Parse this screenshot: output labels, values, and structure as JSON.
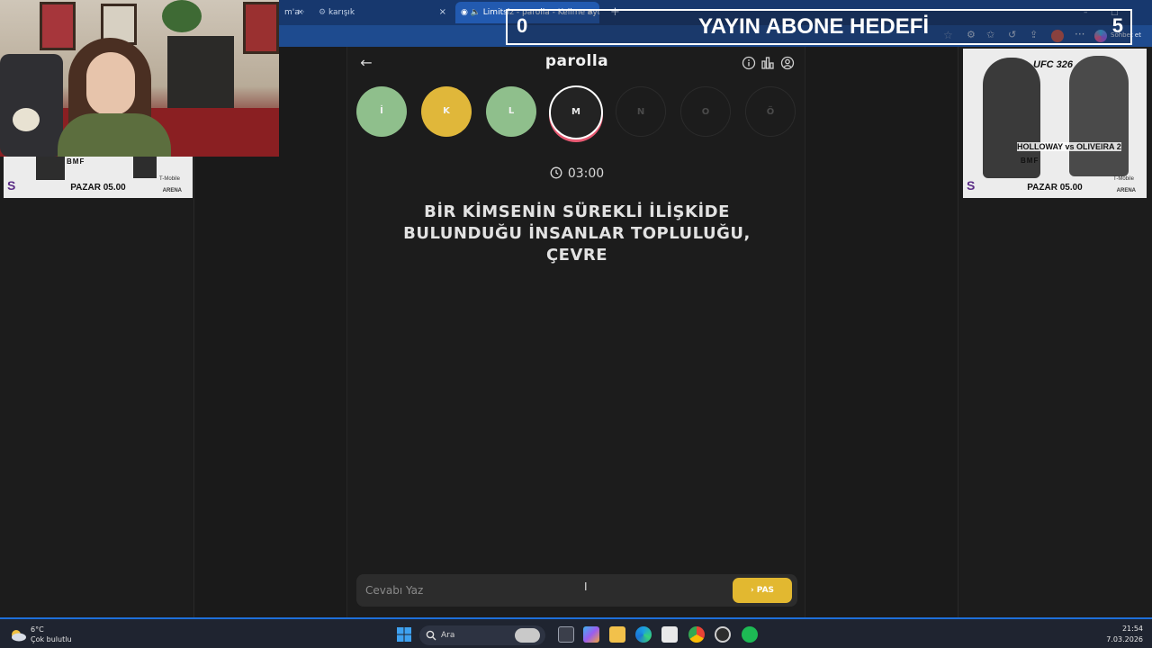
{
  "browser": {
    "tabs": [
      {
        "label": "m'a ·"
      },
      {
        "label": "karışık"
      },
      {
        "label": "Limitsiz - parolla - Kelime oyu"
      }
    ],
    "edge_copilot_label": "Sohbet et"
  },
  "overlay": {
    "goal_current": "0",
    "goal_title": "YAYIN ABONE HEDEFİ",
    "goal_target": "5"
  },
  "ads": {
    "date": "PAZAR 05.00",
    "bmf": "BMF",
    "tmobile": "T-Mobile",
    "arena": "ARENA",
    "ufc": "UFC 326",
    "fighters": "HOLLOWAY vs OLIVEIRA 2"
  },
  "game": {
    "logo": "parolla",
    "letters": [
      {
        "char": "İ",
        "state": "correct"
      },
      {
        "char": "K",
        "state": "passed"
      },
      {
        "char": "L",
        "state": "correct"
      },
      {
        "char": "M",
        "state": "current"
      },
      {
        "char": "N",
        "state": "empty"
      },
      {
        "char": "O",
        "state": "empty"
      },
      {
        "char": "Ö",
        "state": "empty"
      }
    ],
    "timer": "03:00",
    "clue": "BİR KİMSENİN SÜREKLİ İLİŞKİDE BULUNDUĞU İNSANLAR TOPLULUĞU, ÇEVRE",
    "answer_placeholder": "Cevabı Yaz",
    "pass_label": "› PAS",
    "colors": {
      "correct": "#8fbf8c",
      "passed": "#e0b73a",
      "current_ring": "#e85a73"
    }
  },
  "taskbar": {
    "weather_temp": "6°C",
    "weather_desc": "Çok bulutlu",
    "search_placeholder": "Ara",
    "time": "21:54",
    "date": "7.03.2026"
  }
}
